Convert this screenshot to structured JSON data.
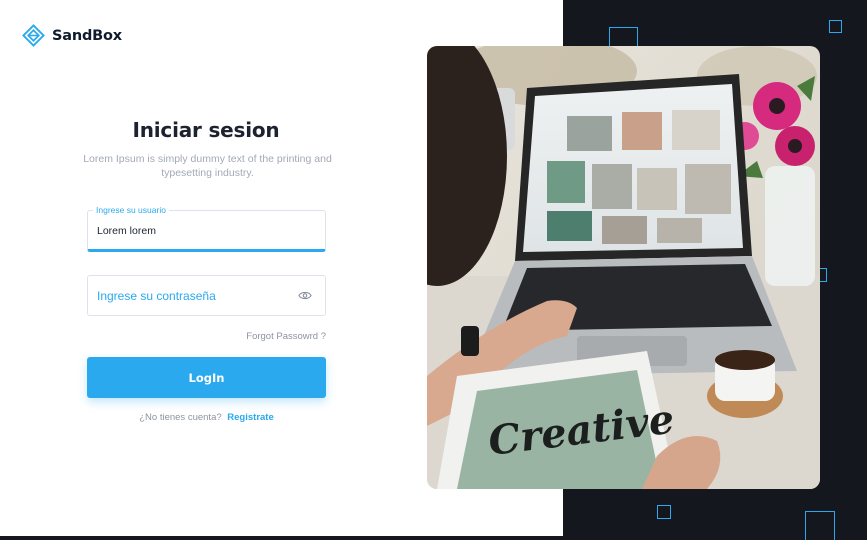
{
  "brand": {
    "name": "SandBox",
    "logo_icon": "box-logo-icon",
    "accent_color": "#2aa9ef",
    "dark_color": "#14181e"
  },
  "login": {
    "title": "Iniciar sesion",
    "subtitle": "Lorem Ipsum is simply dummy text of the printing and typesetting industry.",
    "username": {
      "label": "Ingrese su usuario",
      "value": "Lorem lorem"
    },
    "password": {
      "placeholder": "Ingrese su contraseña",
      "toggle_icon": "eye-icon"
    },
    "forgot_label": "Forgot Passowrd ?",
    "login_label": "LogIn",
    "signup_prompt": "¿No tienes cuenta?",
    "signup_link": "Registrate"
  },
  "hero_image": {
    "subject": "person using laptop with tablet showing handwritten lettering",
    "tablet_text": "Creative"
  }
}
